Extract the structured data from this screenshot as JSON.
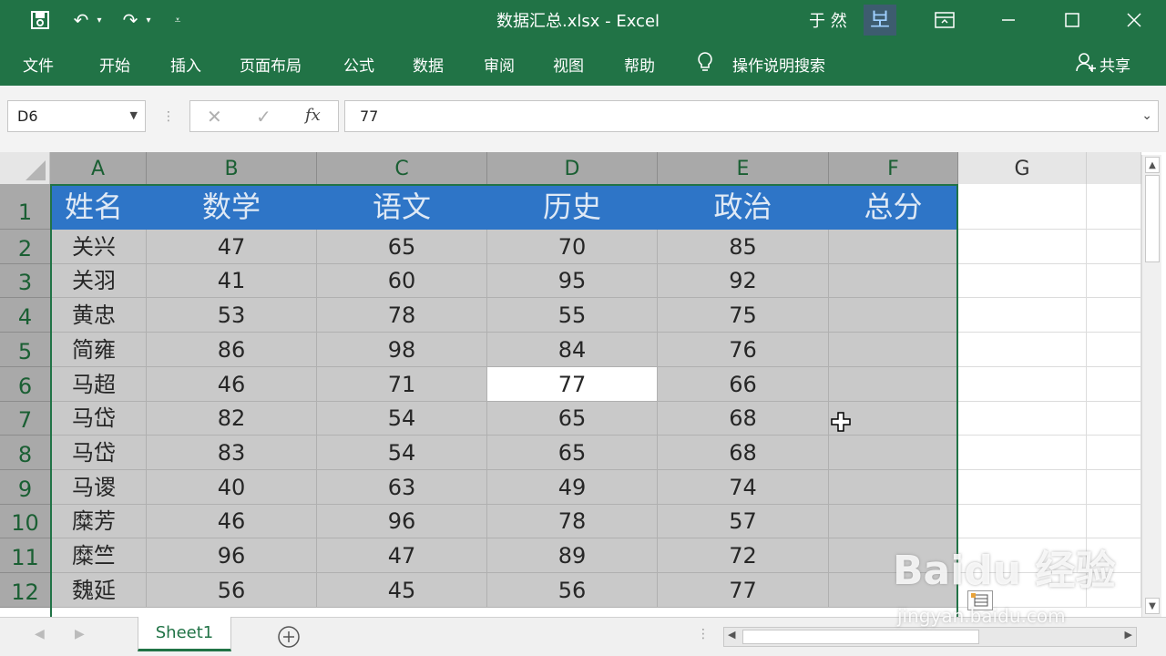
{
  "titlebar": {
    "title": "数据汇总.xlsx  -  Excel",
    "user": "于 然",
    "avatar": "보"
  },
  "ribbon": {
    "tabs": [
      "文件",
      "开始",
      "插入",
      "页面布局",
      "公式",
      "数据",
      "审阅",
      "视图",
      "帮助"
    ],
    "tell_me": "操作说明搜索",
    "share": "共享"
  },
  "formula_bar": {
    "name_box": "D6",
    "fx": "fx",
    "value": "77"
  },
  "columns": [
    "A",
    "B",
    "C",
    "D",
    "E",
    "F",
    "G"
  ],
  "rows": [
    "1",
    "2",
    "3",
    "4",
    "5",
    "6",
    "7",
    "8",
    "9",
    "10",
    "11",
    "12"
  ],
  "table": {
    "headers": [
      "姓名",
      "数学",
      "语文",
      "历史",
      "政治",
      "总分"
    ],
    "data": [
      [
        "关兴",
        "47",
        "65",
        "70",
        "85",
        ""
      ],
      [
        "关羽",
        "41",
        "60",
        "95",
        "92",
        ""
      ],
      [
        "黄忠",
        "53",
        "78",
        "55",
        "75",
        ""
      ],
      [
        "简雍",
        "86",
        "98",
        "84",
        "76",
        ""
      ],
      [
        "马超",
        "46",
        "71",
        "77",
        "66",
        ""
      ],
      [
        "马岱",
        "82",
        "54",
        "65",
        "68",
        ""
      ],
      [
        "马岱",
        "83",
        "54",
        "65",
        "68",
        ""
      ],
      [
        "马谡",
        "40",
        "63",
        "49",
        "74",
        ""
      ],
      [
        "糜芳",
        "46",
        "96",
        "78",
        "57",
        ""
      ],
      [
        "糜竺",
        "96",
        "47",
        "89",
        "72",
        ""
      ],
      [
        "魏延",
        "56",
        "45",
        "56",
        "77",
        ""
      ]
    ]
  },
  "sheets": {
    "active": "Sheet1"
  },
  "watermark": {
    "brand": "Baidu 经验",
    "url": "jingyan.baidu.com"
  },
  "colors": {
    "excel_green": "#217346",
    "header_blue": "#2e75c7",
    "selection_gray": "#c9c9c9"
  }
}
